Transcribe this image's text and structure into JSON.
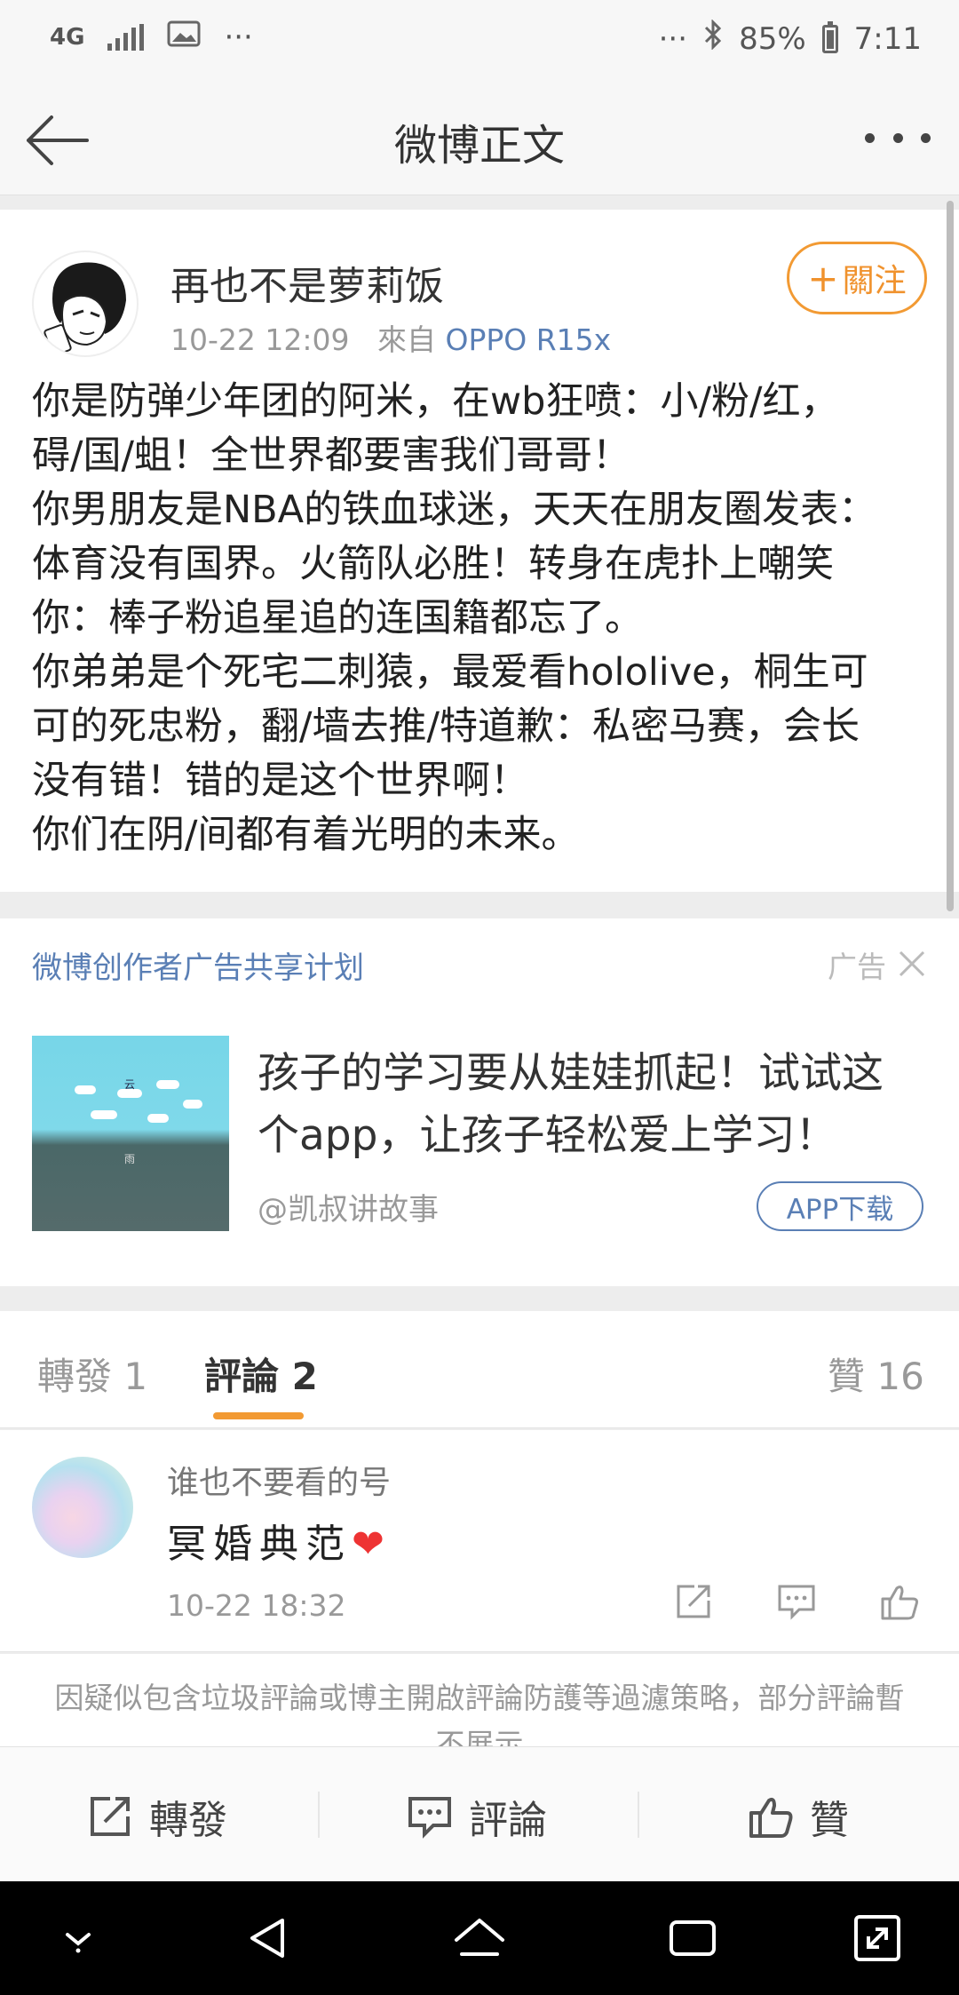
{
  "status_bar": {
    "network": "4G",
    "notif_more": "···",
    "right_more": "···",
    "battery": "85%",
    "time": "7:11"
  },
  "header": {
    "title": "微博正文"
  },
  "post": {
    "author": "再也不是萝莉饭",
    "date": "10-22 12:09",
    "from_label": "來自",
    "source": "OPPO R15x",
    "follow_label": "關注",
    "lines": [
      "你是防弹少年团的阿米，在wb狂喷：小/粉/红，",
      "碍/国/蛆！全世界都要害我们哥哥！",
      "你男朋友是NBA的铁血球迷，天天在朋友圈发表：",
      "体育没有国界。火箭队必胜！转身在虎扑上嘲笑",
      "你：棒子粉追星追的连国籍都忘了。",
      "你弟弟是个死宅二刺猿，最爱看hololive，桐生可",
      "可的死忠粉，翻/墙去推/特道歉：私密马赛，会长",
      "没有错！错的是这个世界啊！",
      "你们在阴/间都有着光明的未来。"
    ]
  },
  "ad": {
    "plan_label": "微博创作者广告共享计划",
    "tag": "广告",
    "headline": "孩子的学习要从娃娃抓起！试试这个app，让孩子轻松爱上学习！",
    "author": "@凯叔讲故事",
    "button": "APP下载",
    "thumb_text_1": "云",
    "thumb_text_2": "雨"
  },
  "tabs": {
    "repost": "轉發 1",
    "comments": "評論 2",
    "likes": "贊 16"
  },
  "comment": {
    "user": "谁也不要看的号",
    "text": "冥婚典范",
    "emoji": "❤",
    "time": "10-22 18:32"
  },
  "notice": {
    "text": "因疑似包含垃圾評論或博主開啟評論防護等過濾策略，部分評論暫不展示"
  },
  "actions": {
    "repost": "轉發",
    "comment": "評論",
    "like": "贊"
  },
  "colors": {
    "accent_orange": "#f29a33",
    "link_blue": "#5a7fb5"
  }
}
